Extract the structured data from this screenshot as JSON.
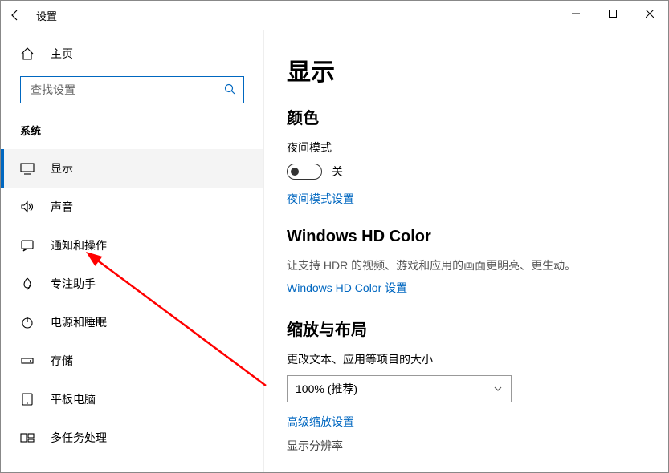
{
  "window": {
    "title": "设置"
  },
  "sidebar": {
    "home": "主页",
    "search_placeholder": "查找设置",
    "group": "系统",
    "items": [
      {
        "label": "显示"
      },
      {
        "label": "声音"
      },
      {
        "label": "通知和操作"
      },
      {
        "label": "专注助手"
      },
      {
        "label": "电源和睡眠"
      },
      {
        "label": "存储"
      },
      {
        "label": "平板电脑"
      },
      {
        "label": "多任务处理"
      }
    ]
  },
  "content": {
    "title": "显示",
    "color_section": "颜色",
    "night_mode_label": "夜间模式",
    "night_mode_state": "关",
    "night_mode_settings": "夜间模式设置",
    "hd_section": "Windows HD Color",
    "hd_desc": "让支持 HDR 的视频、游戏和应用的画面更明亮、更生动。",
    "hd_settings": "Windows HD Color 设置",
    "scale_section": "缩放与布局",
    "scale_label": "更改文本、应用等项目的大小",
    "scale_value": "100% (推荐)",
    "adv_scale": "高级缩放设置",
    "resolution_label": "显示分辨率"
  }
}
